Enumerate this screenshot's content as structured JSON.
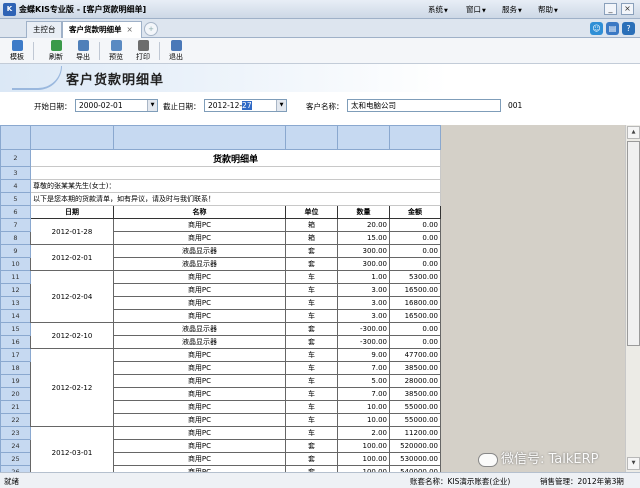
{
  "app": {
    "icon_glyph": "K",
    "title": "金蝶KIS专业版 - [客户货款明细单]",
    "menus": [
      {
        "label": "系统"
      },
      {
        "label": "窗口"
      },
      {
        "label": "服务"
      },
      {
        "label": "帮助"
      }
    ],
    "window_buttons": {
      "minimize": "_",
      "close": "×"
    }
  },
  "tabs": [
    {
      "label": "主控台",
      "active": false
    },
    {
      "label": "客户货款明细单",
      "active": true,
      "close": "×"
    }
  ],
  "toolbar": {
    "buttons": [
      {
        "label": "模板",
        "icon": "template-icon",
        "color": "#3d7bc8"
      },
      {
        "label": "刷新",
        "icon": "refresh-icon",
        "color": "#3a9a4a"
      },
      {
        "label": "导出",
        "icon": "export-icon",
        "color": "#4f7fb9"
      },
      {
        "label": "预览",
        "icon": "preview-icon",
        "color": "#5a8ac2"
      },
      {
        "label": "打印",
        "icon": "print-icon",
        "color": "#6d6d6d"
      },
      {
        "label": "退出",
        "icon": "exit-icon",
        "color": "#4a78b8"
      }
    ]
  },
  "page_title": "客户货款明细单",
  "filters": {
    "start_label": "开始日期：",
    "start_value": "2000-02-01",
    "end_label": "截止日期：",
    "end_value_prefix": "2012-12-",
    "end_value_day": "27",
    "customer_label": "客户名称：",
    "customer_value": "太和电脑公司",
    "customer_code": "001"
  },
  "sheet": {
    "title": "货款明细单",
    "greeting": "尊敬的张某某先生(女士)：",
    "notice": "以下是您本期的货款清单，如有异议，请及时与我们联系！",
    "columns": [
      "日期",
      "名称",
      "单位",
      "数量",
      "金额"
    ],
    "row_numbers": [
      "2",
      "3",
      "4",
      "5",
      "6",
      "7",
      "8",
      "9",
      "10",
      "11",
      "12",
      "13",
      "14",
      "15",
      "16",
      "17",
      "18",
      "19",
      "20",
      "21",
      "22",
      "23",
      "24",
      "25",
      "26"
    ],
    "rows": [
      {
        "rn": "7",
        "date": "2012-01-28",
        "span": 2,
        "name": "商用PC",
        "unit": "箱",
        "qty": "20.00",
        "amount": "0.00"
      },
      {
        "rn": "8",
        "name": "商用PC",
        "unit": "箱",
        "qty": "15.00",
        "amount": "0.00"
      },
      {
        "rn": "9",
        "date": "2012-02-01",
        "span": 2,
        "name": "液晶显示器",
        "unit": "套",
        "qty": "300.00",
        "amount": "0.00"
      },
      {
        "rn": "10",
        "name": "液晶显示器",
        "unit": "套",
        "qty": "300.00",
        "amount": "0.00"
      },
      {
        "rn": "11",
        "date": "2012-02-04",
        "span": 4,
        "name": "商用PC",
        "unit": "车",
        "qty": "1.00",
        "amount": "5300.00"
      },
      {
        "rn": "12",
        "name": "商用PC",
        "unit": "车",
        "qty": "3.00",
        "amount": "16500.00"
      },
      {
        "rn": "13",
        "name": "商用PC",
        "unit": "车",
        "qty": "3.00",
        "amount": "16800.00"
      },
      {
        "rn": "14",
        "name": "商用PC",
        "unit": "车",
        "qty": "3.00",
        "amount": "16500.00"
      },
      {
        "rn": "15",
        "date": "2012-02-10",
        "span": 2,
        "name": "液晶显示器",
        "unit": "套",
        "qty": "-300.00",
        "amount": "0.00"
      },
      {
        "rn": "16",
        "name": "液晶显示器",
        "unit": "套",
        "qty": "-300.00",
        "amount": "0.00"
      },
      {
        "rn": "17",
        "date": "2012-02-12",
        "span": 6,
        "name": "商用PC",
        "unit": "车",
        "qty": "9.00",
        "amount": "47700.00"
      },
      {
        "rn": "18",
        "name": "商用PC",
        "unit": "车",
        "qty": "7.00",
        "amount": "38500.00"
      },
      {
        "rn": "19",
        "name": "商用PC",
        "unit": "车",
        "qty": "5.00",
        "amount": "28000.00"
      },
      {
        "rn": "20",
        "name": "商用PC",
        "unit": "车",
        "qty": "7.00",
        "amount": "38500.00"
      },
      {
        "rn": "21",
        "name": "商用PC",
        "unit": "车",
        "qty": "10.00",
        "amount": "55000.00"
      },
      {
        "rn": "22",
        "name": "商用PC",
        "unit": "车",
        "qty": "10.00",
        "amount": "55000.00"
      },
      {
        "rn": "23",
        "date": "2012-03-01",
        "span": 4,
        "name": "商用PC",
        "unit": "车",
        "qty": "2.00",
        "amount": "11200.00"
      },
      {
        "rn": "24",
        "name": "商用PC",
        "unit": "套",
        "qty": "100.00",
        "amount": "520000.00"
      },
      {
        "rn": "25",
        "name": "商用PC",
        "unit": "套",
        "qty": "100.00",
        "amount": "530000.00"
      },
      {
        "rn": "26",
        "name": "商用PC",
        "unit": "套",
        "qty": "100.00",
        "amount": "540000.00"
      }
    ]
  },
  "statusbar": {
    "left": "就绪",
    "account": "账套名称：KIS演示账套(企业)",
    "module": "销售管理：2012年第3期"
  },
  "watermark": "微信号: TalkERP"
}
